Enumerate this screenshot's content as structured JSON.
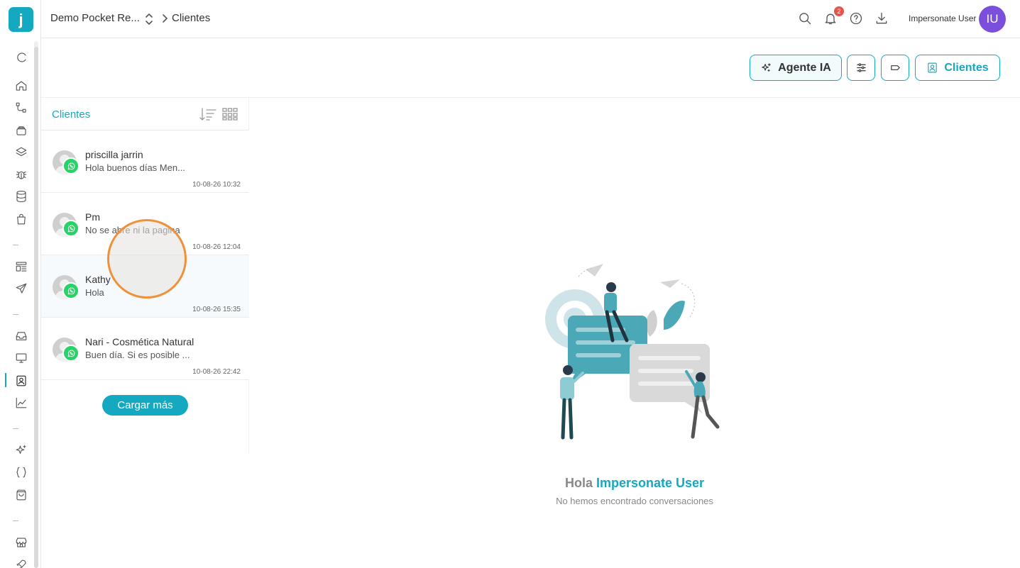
{
  "topbar": {
    "project": "Demo Pocket Re...",
    "current_page": "Clientes",
    "notification_count": "2",
    "user_name": "Impersonate User",
    "user_initials": "IU"
  },
  "toolbar": {
    "agent_label": "Agente IA",
    "clientes_label": "Clientes"
  },
  "list": {
    "title": "Clientes",
    "rows": [
      {
        "name": "priscilla jarrin",
        "message": "Hola buenos días Men...",
        "time": "10-08-26 10:32"
      },
      {
        "name": "Pm",
        "message": "No se abre ni la pagina",
        "time": "10-08-26 12:04"
      },
      {
        "name": "Kathy",
        "message": "Hola",
        "time": "10-08-26 15:35"
      },
      {
        "name": "Nari - Cosmética Natural",
        "message": "Buen día. Si es posible ...",
        "time": "10-08-26 22:42"
      }
    ],
    "load_more": "Cargar más"
  },
  "empty_state": {
    "greeting": "Hola",
    "user": "Impersonate User",
    "message": "No hemos encontrado conversaciones"
  },
  "colors": {
    "accent": "#14a9c0",
    "avatar": "#7b4fdc",
    "whatsapp": "#25d366",
    "badge": "#e5534b",
    "tap_ring": "#f0913a"
  },
  "icons": {
    "rail": [
      "refresh-icon",
      "home-icon",
      "flow-icon",
      "layers-box-icon",
      "stack-icon",
      "bug-icon",
      "database-icon",
      "bag-icon",
      "template-list-icon",
      "send-icon",
      "inbox-icon",
      "monitor-icon",
      "contacts-icon",
      "chart-line-icon",
      "sparkles-icon",
      "code-braces-icon",
      "shopping-bag-icon",
      "store-icon",
      "rocket-icon"
    ],
    "topbar": [
      "search-icon",
      "bell-icon",
      "help-icon",
      "download-icon"
    ]
  }
}
